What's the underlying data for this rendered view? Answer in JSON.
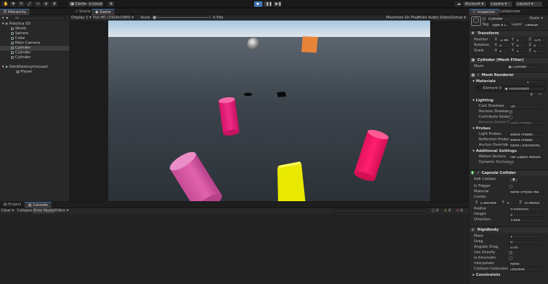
{
  "toolbar": {
    "pivot": "Center",
    "space": "Local",
    "account": "Account",
    "layers": "Layers",
    "layout": "Layout"
  },
  "hierarchy": {
    "tab": "Hierarchy",
    "search_placeholder": "All",
    "items": [
      {
        "label": "Práctica 03",
        "depth": 0,
        "selected": false
      },
      {
        "label": "World",
        "depth": 1,
        "selected": false
      },
      {
        "label": "Sphere",
        "depth": 1,
        "selected": false
      },
      {
        "label": "Cube",
        "depth": 1,
        "selected": false
      },
      {
        "label": "Main Camera",
        "depth": 1,
        "selected": false
      },
      {
        "label": "Cylinder",
        "depth": 1,
        "selected": true
      },
      {
        "label": "Cylinder",
        "depth": 1,
        "selected": false
      },
      {
        "label": "Cylinder",
        "depth": 1,
        "selected": false
      },
      {
        "label": "DontDestroyOnLoad",
        "depth": 0,
        "selected": false
      },
      {
        "label": "Player",
        "depth": 2,
        "selected": false
      }
    ]
  },
  "view": {
    "tab_scene": "Scene",
    "tab_game": "Game",
    "display": "Display 1",
    "resolution": "Full HD (1920x1080)",
    "scale_label": "Scale",
    "scale_value": "0.59x",
    "maximize": "Maximize On Play",
    "mute": "Mute Audio",
    "stats": "Stats",
    "gizmos": "Gizmos"
  },
  "console": {
    "tab_project": "Project",
    "tab_console": "Console",
    "clear": "Clear",
    "collapse": "Collapse",
    "error_pause": "Error Pause",
    "editor": "Editor",
    "counts": [
      "0",
      "0",
      "0"
    ]
  },
  "inspector": {
    "tab_inspector": "Inspector",
    "tab_collaborate": "Collaborate",
    "object_name": "Cylinder",
    "static": "Static",
    "tag_label": "Tag",
    "tag_value": "Type A C",
    "layer_label": "Layer",
    "layer_value": "Default",
    "transform": {
      "title": "Transform",
      "rows": [
        {
          "label": "Position",
          "x": "-2.96",
          "y": "1",
          "z": "-1.4"
        },
        {
          "label": "Rotation",
          "x": "0",
          "y": "0",
          "z": "0"
        },
        {
          "label": "Scale",
          "x": "1",
          "y": "1",
          "z": "1"
        }
      ]
    },
    "mesh_filter": {
      "title": "Cylinder (Mesh Filter)",
      "mesh_label": "Mesh",
      "mesh_value": "Cylinder"
    },
    "mesh_renderer": {
      "title": "Mesh Renderer",
      "materials_label": "Materials",
      "materials_count": "1",
      "element_label": "Element 0",
      "element_value": "PinkSmooth",
      "lighting": "Lighting",
      "cast_shadows_label": "Cast Shadows",
      "cast_shadows_value": "On",
      "receive_shadows_label": "Receive Shadows",
      "contribute_gi_label": "Contribute Global",
      "receive_gi_label": "Receive Global Illu",
      "receive_gi_value": "Light Probes",
      "probes": "Probes",
      "light_probes_label": "Light Probes",
      "light_probes_value": "Blend Probes",
      "reflection_probes_label": "Reflection Probes",
      "reflection_probes_value": "Blend Probes",
      "anchor_label": "Anchor Override",
      "anchor_value": "None (Transform)",
      "additional": "Additional Settings",
      "motion_label": "Motion Vectors",
      "motion_value": "Per Object Motion",
      "occlusion_label": "Dynamic Occlusion"
    },
    "capsule_collider": {
      "title": "Capsule Collider",
      "edit_label": "Edit Collider",
      "trigger_label": "Is Trigger",
      "material_label": "Material",
      "material_value": "None (Physic Ma",
      "center_label": "Center",
      "cx": "5.960464",
      "cy": "0",
      "cz": "-8.94069",
      "radius_label": "Radius",
      "radius_value": "0.5000001",
      "height_label": "Height",
      "height_value": "2",
      "direction_label": "Direction",
      "direction_value": "Y-Axis"
    },
    "rigidbody": {
      "title": "Rigidbody",
      "mass_label": "Mass",
      "mass_value": "1",
      "drag_label": "Drag",
      "drag_value": "0",
      "angular_label": "Angular Drag",
      "angular_value": "0.05",
      "gravity_label": "Use Gravity",
      "kinematic_label": "Is Kinematic",
      "interpolate_label": "Interpolate",
      "interpolate_value": "None",
      "collision_label": "Collision Detection",
      "collision_value": "Discrete",
      "constraints_label": "Constraints"
    }
  },
  "colors": {
    "accent": "#3a72b0",
    "cylinder_magenta": "#e8177a",
    "cylinder_hot": "#ff1a6c",
    "cylinder_light": "#d95aa8",
    "cube_yellow": "#f5f500",
    "cube_orange": "#e8843a",
    "sky": "#a9c4dc"
  }
}
